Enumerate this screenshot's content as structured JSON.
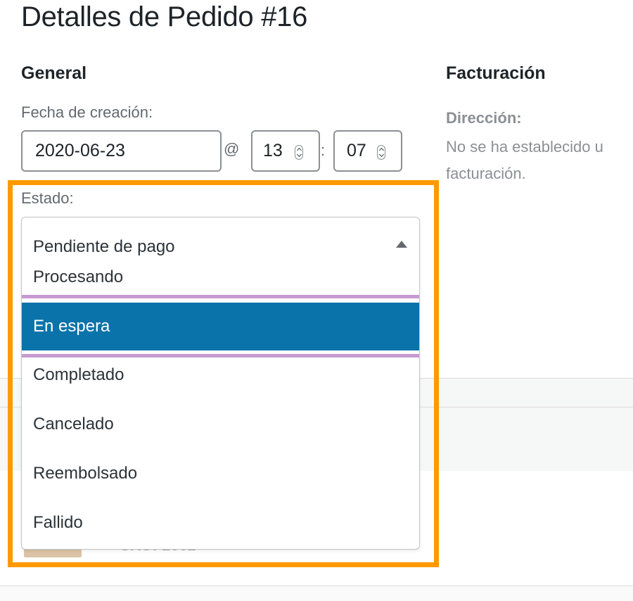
{
  "page": {
    "title": "Detalles de Pedido #16"
  },
  "general": {
    "heading": "General",
    "date_label": "Fecha de creación:",
    "date_value": "2020-06-23",
    "at_separator": "@",
    "hour_value": "13",
    "time_separator": ":",
    "minute_value": "07",
    "status_label": "Estado:",
    "status_selected": "Pendiente de pago",
    "status_options": [
      "Procesando",
      "En espera",
      "Completado",
      "Cancelado",
      "Reembolsado",
      "Fallido"
    ],
    "status_highlighted": "En espera"
  },
  "billing": {
    "heading": "Facturación",
    "address_label": "Dirección:",
    "address_text_line1": "No se ha establecido u",
    "address_text_line2": "facturación."
  },
  "background": {
    "sku_text": "SKU: 1662"
  },
  "colors": {
    "highlight": "#ff9900",
    "active_option": "#0a73aa",
    "focus_bar": "#c79ad1"
  }
}
